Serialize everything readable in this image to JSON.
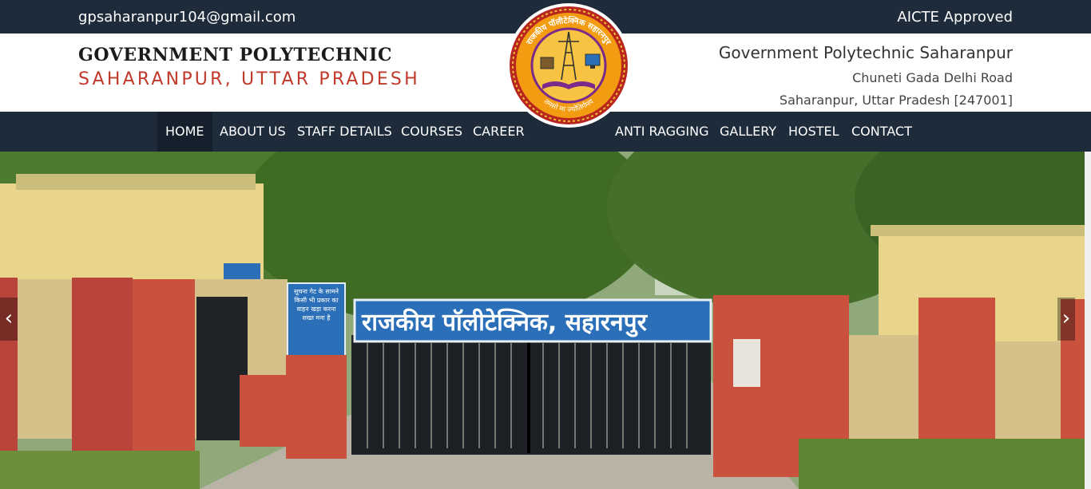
{
  "topbar": {
    "email": "gpsaharanpur104@gmail.com",
    "badge": "AICTE Approved"
  },
  "header": {
    "brand_line1": "GOVERNMENT POLYTECHNIC",
    "brand_line2": "SAHARANPUR, UTTAR PRADESH",
    "address_line1": "Government Polytechnic Saharanpur",
    "address_line2": "Chuneti Gada Delhi Road",
    "address_line3": "Saharanpur, Uttar Pradesh [247001]"
  },
  "logo": {
    "text_top": "राजकीय पॉलीटेक्निक सहारनपुर",
    "text_bottom": "तमसो मा ज्योतिर्गमय"
  },
  "nav": {
    "items": [
      {
        "label": "HOME"
      },
      {
        "label": "ABOUT US"
      },
      {
        "label": "STAFF DETAILS"
      },
      {
        "label": "COURSES"
      },
      {
        "label": "CAREER"
      },
      {
        "label": "ANTI RAGGING"
      },
      {
        "label": "GALLERY"
      },
      {
        "label": "HOSTEL"
      },
      {
        "label": "CONTACT"
      }
    ],
    "active_index": 0
  },
  "hero": {
    "gate_sign": "राजकीय पॉलीटेक्निक, सहारनपुर",
    "notice_board": "सूचना गेट के सामने किसी भी प्रकार का वाहन खड़ा करना सख्त मना है",
    "prev_icon": "chevron-left-icon",
    "next_icon": "chevron-right-icon"
  },
  "colors": {
    "bar_bg": "#1e2b3a",
    "brand_red": "#c0392b",
    "sign_blue": "#2a6fb8"
  }
}
